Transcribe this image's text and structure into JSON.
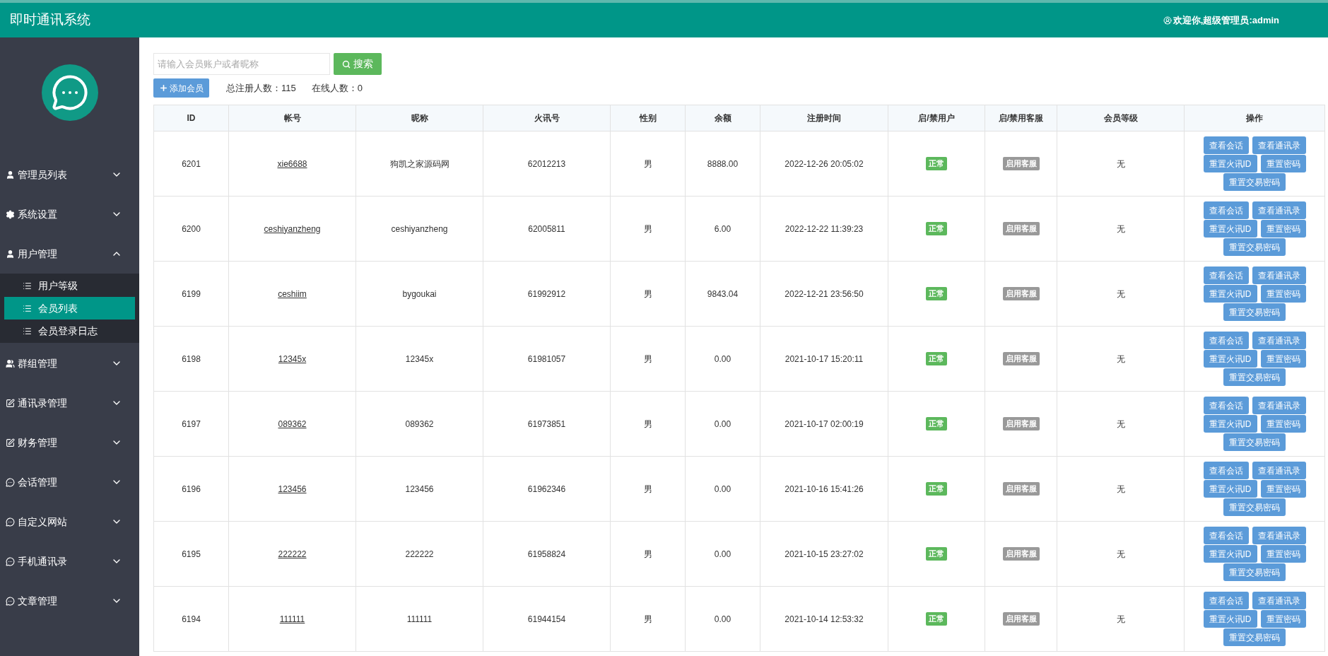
{
  "header": {
    "title": "即时通讯系统",
    "welcome": "欢迎你,超级管理员:admin"
  },
  "sidebar": {
    "menu": [
      {
        "label": "管理员列表",
        "expanded": false
      },
      {
        "label": "系统设置",
        "expanded": false
      },
      {
        "label": "用户管理",
        "expanded": true,
        "children": [
          {
            "label": "用户等级",
            "selected": false
          },
          {
            "label": "会员列表",
            "selected": true
          },
          {
            "label": "会员登录日志",
            "selected": false
          }
        ]
      },
      {
        "label": "群组管理",
        "expanded": false
      },
      {
        "label": "通讯录管理",
        "expanded": false
      },
      {
        "label": "财务管理",
        "expanded": false
      },
      {
        "label": "会话管理",
        "expanded": false
      },
      {
        "label": "自定义网站",
        "expanded": false
      },
      {
        "label": "手机通讯录",
        "expanded": false
      },
      {
        "label": "文章管理",
        "expanded": false
      }
    ]
  },
  "toolbar": {
    "search_placeholder": "请输入会员账户或者昵称",
    "search_button": "搜索",
    "add_button": "添加会员",
    "stats": [
      "总注册人数：115",
      "在线人数：0"
    ]
  },
  "table": {
    "columns": [
      "ID",
      "帐号",
      "昵称",
      "火讯号",
      "性别",
      "余额",
      "注册时间",
      "启/禁用户",
      "启/禁用客服",
      "会员等级",
      "操作"
    ],
    "rows": [
      {
        "id": "6201",
        "account": "xie6688",
        "nickname": "狗凯之家源码网",
        "huoxun": "62012213",
        "gender": "男",
        "balance": "8888.00",
        "registered": "2022-12-26 20:05:02",
        "user_status": "正常",
        "service": "启用客服",
        "level": "无",
        "actions": [
          "查看会话",
          "查看通讯录",
          "重置火讯ID",
          "重置密码",
          "重置交易密码"
        ]
      },
      {
        "id": "6200",
        "account": "ceshiyanzheng",
        "nickname": "ceshiyanzheng",
        "huoxun": "62005811",
        "gender": "男",
        "balance": "6.00",
        "registered": "2022-12-22 11:39:23",
        "user_status": "正常",
        "service": "启用客服",
        "level": "无",
        "actions": [
          "查看会话",
          "查看通讯录",
          "重置火讯ID",
          "重置密码",
          "重置交易密码"
        ]
      },
      {
        "id": "6199",
        "account": "ceshiim",
        "nickname": "bygoukai",
        "huoxun": "61992912",
        "gender": "男",
        "balance": "9843.04",
        "registered": "2022-12-21 23:56:50",
        "user_status": "正常",
        "service": "启用客服",
        "level": "无",
        "actions": [
          "查看会话",
          "查看通讯录",
          "重置火讯ID",
          "重置密码",
          "重置交易密码"
        ]
      },
      {
        "id": "6198",
        "account": "12345x",
        "nickname": "12345x",
        "huoxun": "61981057",
        "gender": "男",
        "balance": "0.00",
        "registered": "2021-10-17 15:20:11",
        "user_status": "正常",
        "service": "启用客服",
        "level": "无",
        "actions": [
          "查看会话",
          "查看通讯录",
          "重置火讯ID",
          "重置密码",
          "重置交易密码"
        ]
      },
      {
        "id": "6197",
        "account": "089362",
        "nickname": "089362",
        "huoxun": "61973851",
        "gender": "男",
        "balance": "0.00",
        "registered": "2021-10-17 02:00:19",
        "user_status": "正常",
        "service": "启用客服",
        "level": "无",
        "actions": [
          "查看会话",
          "查看通讯录",
          "重置火讯ID",
          "重置密码",
          "重置交易密码"
        ]
      },
      {
        "id": "6196",
        "account": "123456",
        "nickname": "123456",
        "huoxun": "61962346",
        "gender": "男",
        "balance": "0.00",
        "registered": "2021-10-16 15:41:26",
        "user_status": "正常",
        "service": "启用客服",
        "level": "无",
        "actions": [
          "查看会话",
          "查看通讯录",
          "重置火讯ID",
          "重置密码",
          "重置交易密码"
        ]
      },
      {
        "id": "6195",
        "account": "222222",
        "nickname": "222222",
        "huoxun": "61958824",
        "gender": "男",
        "balance": "0.00",
        "registered": "2021-10-15 23:27:02",
        "user_status": "正常",
        "service": "启用客服",
        "level": "无",
        "actions": [
          "查看会话",
          "查看通讯录",
          "重置火讯ID",
          "重置密码",
          "重置交易密码"
        ]
      },
      {
        "id": "6194",
        "account": "111111",
        "nickname": "111111",
        "huoxun": "61944154",
        "gender": "男",
        "balance": "0.00",
        "registered": "2021-10-14 12:53:32",
        "user_status": "正常",
        "service": "启用客服",
        "level": "无",
        "actions": [
          "查看会话",
          "查看通讯录",
          "重置火讯ID",
          "重置密码",
          "重置交易密码"
        ]
      }
    ]
  }
}
